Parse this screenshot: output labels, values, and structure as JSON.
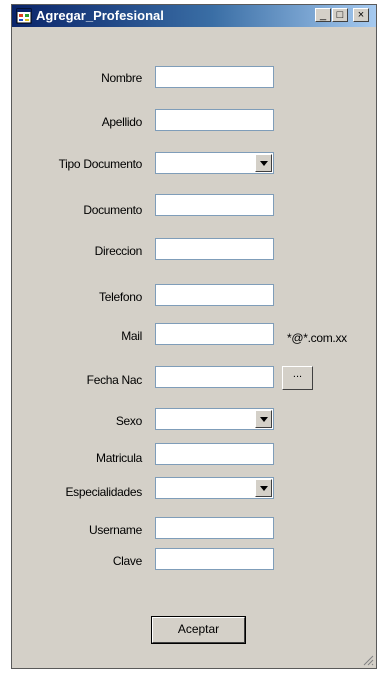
{
  "window": {
    "title": "Agregar_Profesional",
    "min_glyph": "_",
    "max_glyph": "□",
    "close_glyph": "×"
  },
  "form": {
    "nombre": {
      "label": "Nombre",
      "value": ""
    },
    "apellido": {
      "label": "Apellido",
      "value": ""
    },
    "tipo_documento": {
      "label": "Tipo Documento",
      "value": ""
    },
    "documento": {
      "label": "Documento",
      "value": ""
    },
    "direccion": {
      "label": "Direccion",
      "value": ""
    },
    "telefono": {
      "label": "Telefono",
      "value": ""
    },
    "mail": {
      "label": "Mail",
      "value": "",
      "hint": "*@*.com.xx"
    },
    "fecha_nac": {
      "label": "Fecha Nac",
      "value": "",
      "picker_label": "..."
    },
    "sexo": {
      "label": "Sexo",
      "value": ""
    },
    "matricula": {
      "label": "Matricula",
      "value": ""
    },
    "especialidades": {
      "label": "Especialidades",
      "value": ""
    },
    "username": {
      "label": "Username",
      "value": ""
    },
    "clave": {
      "label": "Clave",
      "value": ""
    }
  },
  "actions": {
    "accept_label": "Aceptar"
  },
  "icons": {
    "app": "app-window-icon",
    "dropdown": "chevron-down-icon",
    "resize": "resize-grip-icon"
  }
}
